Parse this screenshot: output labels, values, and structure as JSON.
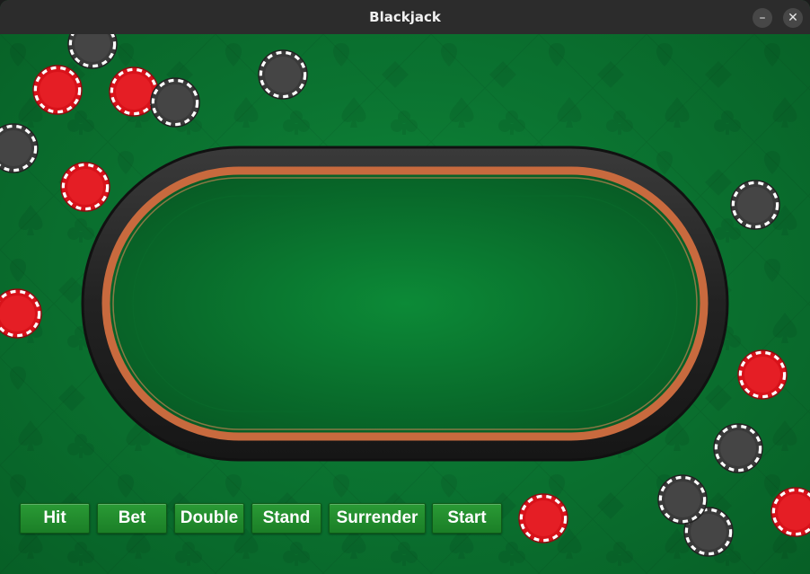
{
  "window": {
    "title": "Blackjack",
    "minimize_icon": "minimize-icon",
    "close_icon": "close-icon"
  },
  "colors": {
    "felt": "#0b7431",
    "rail": "#2a2a2a",
    "rail_trim": "#c86a3e",
    "button": "#229030",
    "chip_red": "#d8121a",
    "chip_black": "#3a3a3a"
  },
  "controls": {
    "buttons": [
      "Hit",
      "Bet",
      "Double",
      "Stand",
      "Surrender",
      "Start"
    ]
  },
  "icons": {
    "chip_red": "red-poker-chip-icon",
    "chip_black": "black-poker-chip-icon",
    "suits": "card-suit-pattern"
  }
}
